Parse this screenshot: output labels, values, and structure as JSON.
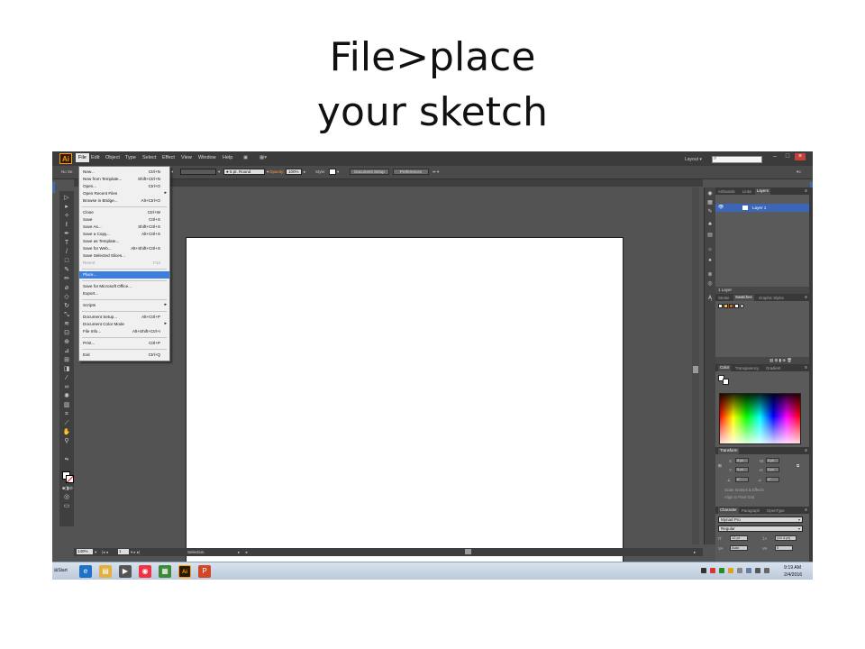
{
  "slide": {
    "title_line1": "File>place",
    "title_line2": "your sketch"
  },
  "app": {
    "logo": "Ai",
    "menu": [
      "File",
      "Edit",
      "Object",
      "Type",
      "Select",
      "Effect",
      "View",
      "Window",
      "Help"
    ],
    "layout_label": "Layout",
    "search_icon": "search-icon"
  },
  "controlbar": {
    "no_selection": "No Se",
    "stroke_profile": "5 pt. Round",
    "opacity_label": "Opacity:",
    "opacity_value": "100%",
    "style_label": "Style:",
    "document_setup": "Document Setup",
    "preferences": "Preferences"
  },
  "file_menu": {
    "items": [
      {
        "label": "New...",
        "shortcut": "Ctrl+N"
      },
      {
        "label": "New from Template...",
        "shortcut": "Shift+Ctrl+N"
      },
      {
        "label": "Open...",
        "shortcut": "Ctrl+O"
      },
      {
        "label": "Open Recent Files",
        "shortcut": ""
      },
      {
        "label": "Browse in Bridge...",
        "shortcut": "Alt+Ctrl+O"
      },
      {
        "label": "Close",
        "shortcut": "Ctrl+W"
      },
      {
        "label": "Save",
        "shortcut": "Ctrl+S"
      },
      {
        "label": "Save As...",
        "shortcut": "Shift+Ctrl+S"
      },
      {
        "label": "Save a Copy...",
        "shortcut": "Alt+Ctrl+S"
      },
      {
        "label": "Save as Template...",
        "shortcut": ""
      },
      {
        "label": "Save for Web...",
        "shortcut": "Alt+Shift+Ctrl+S"
      },
      {
        "label": "Save Selected Slices...",
        "shortcut": ""
      },
      {
        "label": "Revert",
        "shortcut": "F12"
      },
      {
        "label": "Place...",
        "shortcut": ""
      },
      {
        "label": "Save for Microsoft Office...",
        "shortcut": ""
      },
      {
        "label": "Export...",
        "shortcut": ""
      },
      {
        "label": "Scripts",
        "shortcut": ""
      },
      {
        "label": "Document Setup...",
        "shortcut": "Alt+Ctrl+P"
      },
      {
        "label": "Document Color Mode",
        "shortcut": ""
      },
      {
        "label": "File Info...",
        "shortcut": "Alt+Shift+Ctrl+I"
      },
      {
        "label": "Print...",
        "shortcut": "Ctrl+P"
      },
      {
        "label": "Exit",
        "shortcut": "Ctrl+Q"
      }
    ]
  },
  "statusbar": {
    "zoom": "140%",
    "page": "1",
    "status": "Selection"
  },
  "panels": {
    "layers": {
      "tabs": [
        "Artboards",
        "Links",
        "Layers"
      ],
      "active_tab": "Layers",
      "layer_name": "Layer 1",
      "footer": "1 Layer"
    },
    "swatches": {
      "tabs": [
        "Stroke",
        "Swatches",
        "Graphic Styles"
      ],
      "active_tab": "Swatches"
    },
    "color": {
      "tabs": [
        "Color",
        "Transparency",
        "Gradient"
      ],
      "active_tab": "Color"
    },
    "transform": {
      "title": "Transform",
      "x_label": "X:",
      "x": "0 pt",
      "y_label": "Y:",
      "y": "0 pt",
      "w_label": "W:",
      "w": "0 pt",
      "h_label": "H:",
      "h": "0 pt",
      "angle": "0°",
      "shear": "0°",
      "option1": "Scale Strokes & Effects",
      "option2": "Align to Pixel Grid"
    },
    "character": {
      "tabs": [
        "Character",
        "Paragraph",
        "OpenType"
      ],
      "font": "Myriad Pro",
      "style": "Regular",
      "size": "12 pt",
      "leading": "(14.4 pt)",
      "kerning": "Auto",
      "tracking": "0"
    }
  },
  "taskbar": {
    "start": "Start",
    "time": "9:19 AM",
    "date": "2/4/2016"
  },
  "colors": {
    "highlight": "#3c7fe0",
    "ui_dark": "#535353",
    "ai_orange": "#ff9a00",
    "layer_blue": "#3c67b8"
  }
}
